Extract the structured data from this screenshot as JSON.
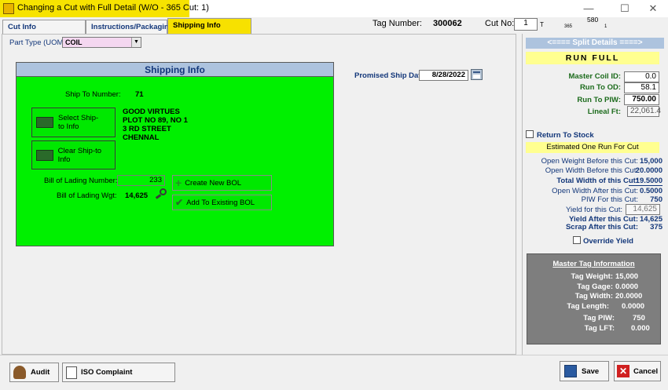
{
  "window": {
    "title": "Changing a Cut with Full Detail  (W/O - 365   Cut: 1)",
    "minimize": "—",
    "maximize": "☐",
    "close": "✕"
  },
  "tabs": [
    "Cut Info",
    "Instructions/Packaging",
    "Shipping Info"
  ],
  "header": {
    "tag_number_label": "Tag Number:",
    "tag_number_value": "300062",
    "cut_no_label": "Cut No:",
    "cut_no_value": "1",
    "cut_no_suffix": "T",
    "top_small_1": "580",
    "top_small_2": "365",
    "top_small_3": "1"
  },
  "part_type": {
    "label": "Part Type (UOM):",
    "value": "COIL"
  },
  "promised_ship": {
    "label": "Promised Ship Date:",
    "value": "8/28/2022"
  },
  "shipping": {
    "title": "Shipping Info",
    "ship_to_number_label": "Ship To Number:",
    "ship_to_number_value": "71",
    "select_btn": "Select Ship-to Info",
    "clear_btn": "Clear Ship-to Info",
    "address": [
      "GOOD VIRTUES",
      "PLOT NO 89, NO 1",
      "3 RD STREET",
      "CHENNAL"
    ],
    "bol_number_label": "Bill of Lading Number:",
    "bol_number_value": "233",
    "bol_weight_label": "Bill of Lading Wgt:",
    "bol_weight_value": "14,625",
    "create_bol": "Create New BOL",
    "add_bol": "Add To Existing BOL"
  },
  "split": {
    "title": "<==== Split Details ====>",
    "run_mode": "RUN   FULL",
    "master_coil_label": "Master Coil ID:",
    "master_coil_value": "0.0",
    "run_to_od_label": "Run To OD:",
    "run_to_od_value": "58.1",
    "run_to_piw_label": "Run To PIW:",
    "run_to_piw_value": "750.00",
    "lineal_ft_label": "Lineal Ft:",
    "lineal_ft_value": "22,061.4",
    "return_stock": "Return To Stock",
    "estimated": "Estimated One Run For Cut",
    "rows": [
      {
        "label": "Open Weight Before this Cut:",
        "value": "15,000"
      },
      {
        "label": "Open Width Before this Cut:",
        "value": "20.0000"
      },
      {
        "label": "Total Width of this Cut:",
        "value": "19.5000"
      },
      {
        "label": "Open Width After this Cut:",
        "value": "0.5000"
      },
      {
        "label": "PIW For this Cut:",
        "value": "750"
      },
      {
        "label": "Yield for this Cut:",
        "value": "14,625"
      },
      {
        "label": "Yield After this Cut:",
        "value": "14,625"
      },
      {
        "label": "Scrap After this Cut:",
        "value": "375"
      }
    ],
    "override_yield": "Override Yield"
  },
  "master_tag": {
    "title": "Master Tag Information",
    "rows": [
      {
        "label": "Tag Weight:",
        "value": "15,000"
      },
      {
        "label": "Tag Gage:",
        "value": "0.0000"
      },
      {
        "label": "Tag Width:",
        "value": "20.0000"
      },
      {
        "label": "Tag Length:",
        "value": "0.0000"
      },
      {
        "label": "Tag PIW:",
        "value": "750"
      },
      {
        "label": "Tag LFT:",
        "value": "0.000"
      }
    ]
  },
  "footer": {
    "audit": "Audit",
    "iso": "ISO Complaint",
    "save": "Save",
    "cancel": "Cancel"
  }
}
